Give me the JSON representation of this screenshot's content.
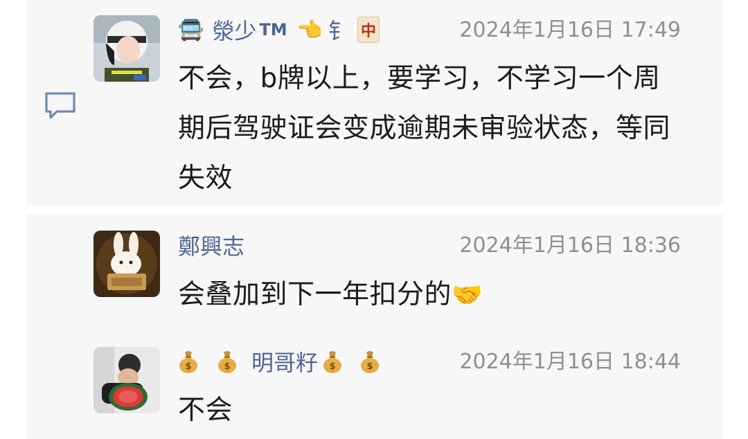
{
  "comments": [
    {
      "user": {
        "prefix_emoji": "🚍",
        "name": "滎少",
        "tm": "TM",
        "pointer_emoji": "👈",
        "cut_char": "钅",
        "mahjong_char": "中"
      },
      "timestamp": "2024年1月16日 17:49",
      "text": "不会，b牌以上，要学习，不学习一个周期后驾驶证会变成逾期未审验状态，等同失效"
    },
    {
      "user": {
        "name": "鄭興志"
      },
      "timestamp": "2024年1月16日 18:36",
      "text": "会叠加到下一年扣分的",
      "trailing_emoji": "🤝"
    },
    {
      "user": {
        "name": "明哥籽"
      },
      "timestamp": "2024年1月16日 18:44",
      "text": "不会"
    }
  ],
  "colors": {
    "username": "#4e6594",
    "timestamp": "#8f8f8f",
    "text": "#1b1b1b",
    "panel": "#f7f7f7"
  },
  "icons": [
    "comment-icon",
    "money-bag-icon"
  ]
}
